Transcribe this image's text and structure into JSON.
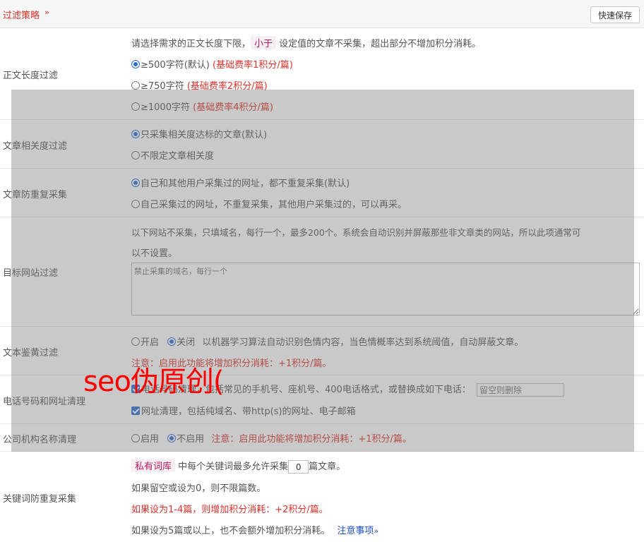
{
  "header": {
    "title": "过滤策略",
    "chevron": "»",
    "save_label": "快速保存"
  },
  "length_filter": {
    "label": "正文长度过滤",
    "desc_before": "请选择需求的正文长度下限，",
    "desc_tag": "小于",
    "desc_after": "设定值的文章不采集，超出部分不增加积分消耗。",
    "options": [
      {
        "text": "≥500字符(默认)",
        "note": "(基础费率1积分/篇)"
      },
      {
        "text": "≥750字符",
        "note": "(基础费率2积分/篇)"
      },
      {
        "text": "≥1000字符",
        "note": "(基础费率4积分/篇)"
      }
    ]
  },
  "relevance_filter": {
    "label": "文章相关度过滤",
    "options": [
      "只采集相关度达标的文章(默认)",
      "不限定文章相关度"
    ]
  },
  "dedup_filter": {
    "label": "文章防重复采集",
    "options": [
      "自己和其他用户采集过的网址，都不重复采集(默认)",
      "自己采集过的网址，不重复采集，其他用户采集过的，可以再采。"
    ]
  },
  "site_filter": {
    "label": "目标网站过滤",
    "desc_line1": "以下网站不采集，只填域名，每行一个，最多200个。系统会自动识别并屏蔽那些非文章类的网站，所以此项通常可",
    "desc_line2": "以不设置。",
    "placeholder": "禁止采集的域名，每行一个"
  },
  "porn_filter": {
    "label": "文本鉴黄过滤",
    "on_label": "开启",
    "off_label": "关闭",
    "desc": "以机器学习算法自动识别色情内容，当色情概率达到系统阈值，自动屏蔽文章。",
    "note": "注意：启用此功能将增加积分消耗：+1积分/篇。"
  },
  "phone_url_filter": {
    "label": "电话号码和网址清理",
    "phone_text": "电话号码清理，包括常见的手机号、座机号、400电话格式，或替换成如下电话：",
    "phone_placeholder": "留空则删除",
    "url_text": "网址清理，包括纯域名、带http(s)的网址、电子邮箱"
  },
  "org_filter": {
    "label": "公司机构名称清理",
    "on_label": "启用",
    "off_label": "不启用",
    "note": "注意：启用此功能将增加积分消耗：+1积分/篇。"
  },
  "keyword_dedup": {
    "label": "关键词防重复采集",
    "tag": "私有词库",
    "line1_before": "中每个关键词最多允许采集",
    "count_value": "0",
    "line1_after": "篇文章。",
    "line2": "如果留空或设为0，则不限篇数。",
    "line3": "如果设为1-4篇，则增加积分消耗：+2积分/篇。",
    "line4": "如果设为5篇或以上，也不会额外增加积分消耗。",
    "notes_link": "注意事项",
    "notes_chevron": "»"
  },
  "watermark": "seo伪原创(",
  "colors": {
    "accent_red": "#d9322a",
    "link_blue": "#1d4fc1",
    "radio_blue": "#2a6fd6"
  }
}
